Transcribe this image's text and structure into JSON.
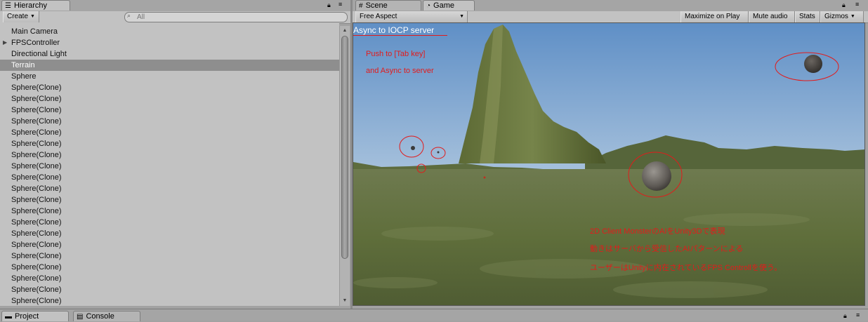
{
  "hierarchy": {
    "tab_label": "Hierarchy",
    "create_label": "Create",
    "search_placeholder": "All",
    "items": [
      {
        "label": "Main Camera"
      },
      {
        "label": "FPSController"
      },
      {
        "label": "Directional Light"
      },
      {
        "label": "Terrain"
      },
      {
        "label": "Sphere"
      },
      {
        "label": "Sphere(Clone)"
      },
      {
        "label": "Sphere(Clone)"
      },
      {
        "label": "Sphere(Clone)"
      },
      {
        "label": "Sphere(Clone)"
      },
      {
        "label": "Sphere(Clone)"
      },
      {
        "label": "Sphere(Clone)"
      },
      {
        "label": "Sphere(Clone)"
      },
      {
        "label": "Sphere(Clone)"
      },
      {
        "label": "Sphere(Clone)"
      },
      {
        "label": "Sphere(Clone)"
      },
      {
        "label": "Sphere(Clone)"
      },
      {
        "label": "Sphere(Clone)"
      },
      {
        "label": "Sphere(Clone)"
      },
      {
        "label": "Sphere(Clone)"
      },
      {
        "label": "Sphere(Clone)"
      },
      {
        "label": "Sphere(Clone)"
      },
      {
        "label": "Sphere(Clone)"
      },
      {
        "label": "Sphere(Clone)"
      },
      {
        "label": "Sphere(Clone)"
      },
      {
        "label": "Sphere(Clone)"
      }
    ],
    "selected_index": 3,
    "expandable_index": 1
  },
  "view_tabs": {
    "scene_label": "Scene",
    "game_label": "Game"
  },
  "game_toolbar": {
    "aspect_label": "Free Aspect",
    "maximize_label": "Maximize on Play",
    "mute_label": "Mute audio",
    "stats_label": "Stats",
    "gizmos_label": "Gizmos"
  },
  "game_view": {
    "title": "Async to IOCP server",
    "hint_line1": "Push to [Tab key]",
    "hint_line2": "and Async to server",
    "note_line1": "2D Client MonsterのAIをUnity3Dで表現",
    "note_line2": "動きはサーバから受信したAIパターンによる",
    "note_line3": "ユーザーはUnityに内在されているFPS Controllを使う。"
  },
  "bottom_tabs": {
    "project_label": "Project",
    "console_label": "Console"
  },
  "colors": {
    "annotation_red": "#e21b1b",
    "selection_gray": "#8e8e8e",
    "panel_bg": "#c2c2c2"
  }
}
